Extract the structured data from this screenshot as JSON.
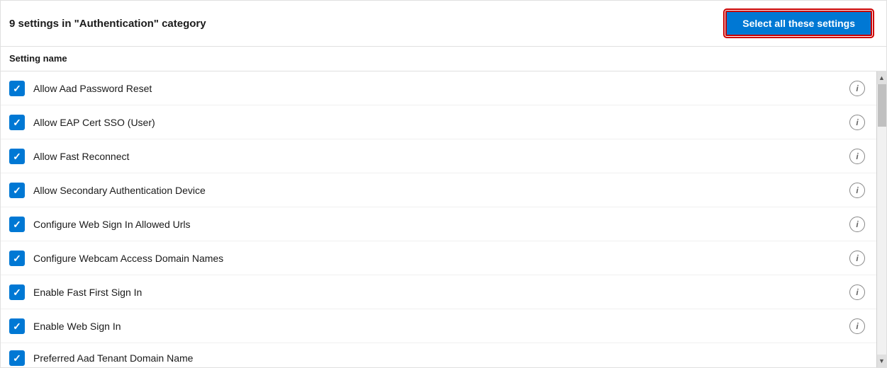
{
  "header": {
    "title": "9 settings in \"Authentication\" category",
    "select_all_label": "Select all these settings"
  },
  "column_header": {
    "setting_name_label": "Setting name"
  },
  "settings": [
    {
      "id": 1,
      "name": "Allow Aad Password Reset",
      "checked": true
    },
    {
      "id": 2,
      "name": "Allow EAP Cert SSO (User)",
      "checked": true
    },
    {
      "id": 3,
      "name": "Allow Fast Reconnect",
      "checked": true
    },
    {
      "id": 4,
      "name": "Allow Secondary Authentication Device",
      "checked": true
    },
    {
      "id": 5,
      "name": "Configure Web Sign In Allowed Urls",
      "checked": true
    },
    {
      "id": 6,
      "name": "Configure Webcam Access Domain Names",
      "checked": true
    },
    {
      "id": 7,
      "name": "Enable Fast First Sign In",
      "checked": true
    },
    {
      "id": 8,
      "name": "Enable Web Sign In",
      "checked": true
    },
    {
      "id": 9,
      "name": "Preferred Aad Tenant Domain Name",
      "checked": true,
      "partial": true
    }
  ],
  "icons": {
    "info": "i",
    "check": "✓",
    "arrow_up": "▲",
    "arrow_down": "▼"
  }
}
